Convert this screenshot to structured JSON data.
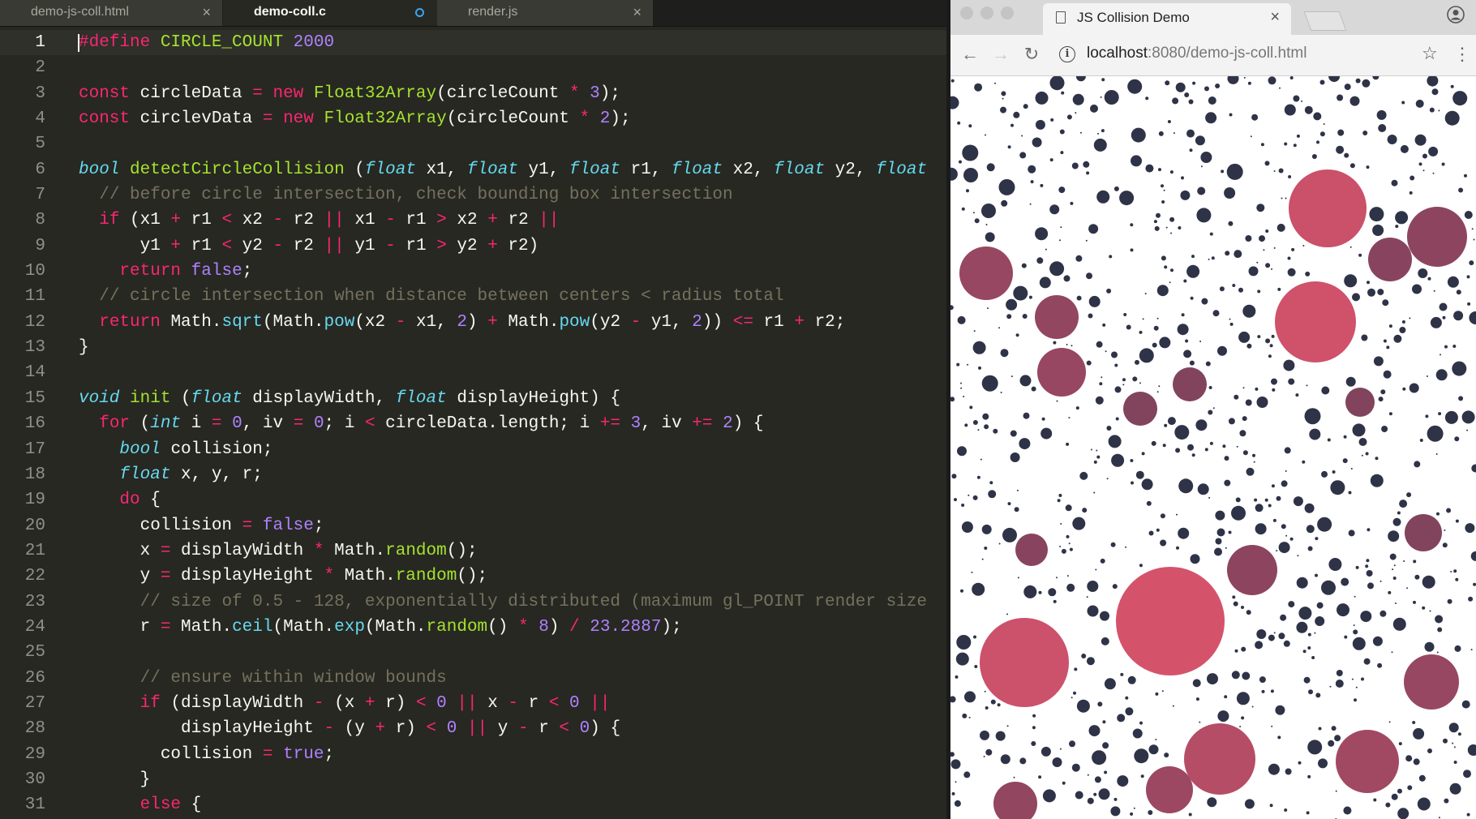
{
  "editor": {
    "tabs": [
      {
        "label": "demo-js-coll.html",
        "state": "inactive",
        "indicator": "close"
      },
      {
        "label": "demo-coll.c",
        "state": "active",
        "indicator": "modified-dot"
      },
      {
        "label": "render.js",
        "state": "inactive",
        "indicator": "close"
      }
    ],
    "close_glyph": "×",
    "current_line": 1,
    "lines": [
      [
        [
          "k",
          "#define"
        ],
        [
          "",
          ""
        ],
        [
          "f",
          " CIRCLE_COUNT"
        ],
        [
          "n",
          " 2000"
        ]
      ],
      [],
      [
        [
          "k",
          "const"
        ],
        [
          "",
          " circleData "
        ],
        [
          "k",
          "="
        ],
        [
          "",
          " "
        ],
        [
          "k",
          "new"
        ],
        [
          "",
          " "
        ],
        [
          "f",
          "Float32Array"
        ],
        [
          "",
          "(circleCount "
        ],
        [
          "k",
          "*"
        ],
        [
          "",
          " "
        ],
        [
          "n",
          "3"
        ],
        [
          "",
          ");"
        ]
      ],
      [
        [
          "k",
          "const"
        ],
        [
          "",
          " circlevData "
        ],
        [
          "k",
          "="
        ],
        [
          "",
          " "
        ],
        [
          "k",
          "new"
        ],
        [
          "",
          " "
        ],
        [
          "f",
          "Float32Array"
        ],
        [
          "",
          "(circleCount "
        ],
        [
          "k",
          "*"
        ],
        [
          "",
          " "
        ],
        [
          "n",
          "2"
        ],
        [
          "",
          ");"
        ]
      ],
      [],
      [
        [
          "s",
          "bool"
        ],
        [
          "",
          " "
        ],
        [
          "f",
          "detectCircleCollision"
        ],
        [
          "",
          " ("
        ],
        [
          "s",
          "float"
        ],
        [
          "",
          " x1, "
        ],
        [
          "s",
          "float"
        ],
        [
          "",
          " y1, "
        ],
        [
          "s",
          "float"
        ],
        [
          "",
          " r1, "
        ],
        [
          "s",
          "float"
        ],
        [
          "",
          " x2, "
        ],
        [
          "s",
          "float"
        ],
        [
          "",
          " y2, "
        ],
        [
          "s",
          "float"
        ]
      ],
      [
        [
          "",
          "  "
        ],
        [
          "c",
          "// before circle intersection, check bounding box intersection"
        ]
      ],
      [
        [
          "",
          "  "
        ],
        [
          "k",
          "if"
        ],
        [
          "",
          " (x1 "
        ],
        [
          "k",
          "+"
        ],
        [
          "",
          " r1 "
        ],
        [
          "k",
          "<"
        ],
        [
          "",
          " x2 "
        ],
        [
          "k",
          "-"
        ],
        [
          "",
          " r2 "
        ],
        [
          "k",
          "||"
        ],
        [
          "",
          " x1 "
        ],
        [
          "k",
          "-"
        ],
        [
          "",
          " r1 "
        ],
        [
          "k",
          ">"
        ],
        [
          "",
          " x2 "
        ],
        [
          "k",
          "+"
        ],
        [
          "",
          " r2 "
        ],
        [
          "k",
          "||"
        ]
      ],
      [
        [
          "",
          "      y1 "
        ],
        [
          "k",
          "+"
        ],
        [
          "",
          " r1 "
        ],
        [
          "k",
          "<"
        ],
        [
          "",
          " y2 "
        ],
        [
          "k",
          "-"
        ],
        [
          "",
          " r2 "
        ],
        [
          "k",
          "||"
        ],
        [
          "",
          " y1 "
        ],
        [
          "k",
          "-"
        ],
        [
          "",
          " r1 "
        ],
        [
          "k",
          ">"
        ],
        [
          "",
          " y2 "
        ],
        [
          "k",
          "+"
        ],
        [
          "",
          " r2)"
        ]
      ],
      [
        [
          "",
          "    "
        ],
        [
          "k",
          "return"
        ],
        [
          "",
          " "
        ],
        [
          "n",
          "false"
        ],
        [
          "",
          ";"
        ]
      ],
      [
        [
          "",
          "  "
        ],
        [
          "c",
          "// circle intersection when distance between centers < radius total"
        ]
      ],
      [
        [
          "",
          "  "
        ],
        [
          "k",
          "return"
        ],
        [
          "",
          " Math."
        ],
        [
          "m",
          "sqrt"
        ],
        [
          "",
          "(Math."
        ],
        [
          "m",
          "pow"
        ],
        [
          "",
          "(x2 "
        ],
        [
          "k",
          "-"
        ],
        [
          "",
          " x1, "
        ],
        [
          "n",
          "2"
        ],
        [
          "",
          ") "
        ],
        [
          "k",
          "+"
        ],
        [
          "",
          " Math."
        ],
        [
          "m",
          "pow"
        ],
        [
          "",
          "(y2 "
        ],
        [
          "k",
          "-"
        ],
        [
          "",
          " y1, "
        ],
        [
          "n",
          "2"
        ],
        [
          "",
          "))"
        ],
        [
          "k",
          " <="
        ],
        [
          "",
          " r1 "
        ],
        [
          "k",
          "+"
        ],
        [
          "",
          " r2;"
        ]
      ],
      [
        [
          "",
          "}"
        ]
      ],
      [],
      [
        [
          "s",
          "void"
        ],
        [
          "",
          " "
        ],
        [
          "f",
          "init"
        ],
        [
          "",
          " ("
        ],
        [
          "s",
          "float"
        ],
        [
          "",
          " displayWidth, "
        ],
        [
          "s",
          "float"
        ],
        [
          "",
          " displayHeight) {"
        ]
      ],
      [
        [
          "",
          "  "
        ],
        [
          "k",
          "for"
        ],
        [
          "",
          " ("
        ],
        [
          "s",
          "int"
        ],
        [
          "",
          " i "
        ],
        [
          "k",
          "="
        ],
        [
          "",
          " "
        ],
        [
          "n",
          "0"
        ],
        [
          "",
          ", iv "
        ],
        [
          "k",
          "="
        ],
        [
          "",
          " "
        ],
        [
          "n",
          "0"
        ],
        [
          "",
          "; i "
        ],
        [
          "k",
          "<"
        ],
        [
          "",
          " circleData.length; i "
        ],
        [
          "k",
          "+="
        ],
        [
          "",
          " "
        ],
        [
          "n",
          "3"
        ],
        [
          "",
          ", iv "
        ],
        [
          "k",
          "+="
        ],
        [
          "",
          " "
        ],
        [
          "n",
          "2"
        ],
        [
          "",
          ") {"
        ]
      ],
      [
        [
          "",
          "    "
        ],
        [
          "s",
          "bool"
        ],
        [
          "",
          " collision;"
        ]
      ],
      [
        [
          "",
          "    "
        ],
        [
          "s",
          "float"
        ],
        [
          "",
          " x, y, r;"
        ]
      ],
      [
        [
          "",
          "    "
        ],
        [
          "k",
          "do"
        ],
        [
          "",
          " {"
        ]
      ],
      [
        [
          "",
          "      collision "
        ],
        [
          "k",
          "="
        ],
        [
          "",
          " "
        ],
        [
          "n",
          "false"
        ],
        [
          "",
          ";"
        ]
      ],
      [
        [
          "",
          "      x "
        ],
        [
          "k",
          "="
        ],
        [
          "",
          " displayWidth "
        ],
        [
          "k",
          "*"
        ],
        [
          "",
          " Math."
        ],
        [
          "f",
          "random"
        ],
        [
          "",
          "();"
        ]
      ],
      [
        [
          "",
          "      y "
        ],
        [
          "k",
          "="
        ],
        [
          "",
          " displayHeight "
        ],
        [
          "k",
          "*"
        ],
        [
          "",
          " Math."
        ],
        [
          "f",
          "random"
        ],
        [
          "",
          "();"
        ]
      ],
      [
        [
          "",
          "      "
        ],
        [
          "c",
          "// size of 0.5 - 128, exponentially distributed (maximum gl_POINT render size"
        ]
      ],
      [
        [
          "",
          "      r "
        ],
        [
          "k",
          "="
        ],
        [
          "",
          " Math."
        ],
        [
          "m",
          "ceil"
        ],
        [
          "",
          "(Math."
        ],
        [
          "m",
          "exp"
        ],
        [
          "",
          "(Math."
        ],
        [
          "f",
          "random"
        ],
        [
          "",
          "() "
        ],
        [
          "k",
          "*"
        ],
        [
          "",
          " "
        ],
        [
          "n",
          "8"
        ],
        [
          "",
          ") "
        ],
        [
          "k",
          "/"
        ],
        [
          "",
          " "
        ],
        [
          "n",
          "23.2887"
        ],
        [
          "",
          ");"
        ]
      ],
      [],
      [
        [
          "",
          "      "
        ],
        [
          "c",
          "// ensure within window bounds"
        ]
      ],
      [
        [
          "",
          "      "
        ],
        [
          "k",
          "if"
        ],
        [
          "",
          " (displayWidth "
        ],
        [
          "k",
          "-"
        ],
        [
          "",
          " (x "
        ],
        [
          "k",
          "+"
        ],
        [
          "",
          " r) "
        ],
        [
          "k",
          "<"
        ],
        [
          "",
          " "
        ],
        [
          "n",
          "0"
        ],
        [
          "",
          " "
        ],
        [
          "k",
          "||"
        ],
        [
          "",
          " x "
        ],
        [
          "k",
          "-"
        ],
        [
          "",
          " r "
        ],
        [
          "k",
          "<"
        ],
        [
          "",
          " "
        ],
        [
          "n",
          "0"
        ],
        [
          "",
          " "
        ],
        [
          "k",
          "||"
        ]
      ],
      [
        [
          "",
          "          displayHeight "
        ],
        [
          "k",
          "-"
        ],
        [
          "",
          " (y "
        ],
        [
          "k",
          "+"
        ],
        [
          "",
          " r) "
        ],
        [
          "k",
          "<"
        ],
        [
          "",
          " "
        ],
        [
          "n",
          "0"
        ],
        [
          "",
          " "
        ],
        [
          "k",
          "||"
        ],
        [
          "",
          " y "
        ],
        [
          "k",
          "-"
        ],
        [
          "",
          " r "
        ],
        [
          "k",
          "<"
        ],
        [
          "",
          " "
        ],
        [
          "n",
          "0"
        ],
        [
          "",
          ") {"
        ]
      ],
      [
        [
          "",
          "        collision "
        ],
        [
          "k",
          "="
        ],
        [
          "",
          " "
        ],
        [
          "n",
          "true"
        ],
        [
          "",
          ";"
        ]
      ],
      [
        [
          "",
          "      }"
        ]
      ],
      [
        [
          "",
          "      "
        ],
        [
          "k",
          "else"
        ],
        [
          "",
          " {"
        ]
      ]
    ]
  },
  "browser": {
    "tab_title": "JS Collision Demo",
    "tab_close": "×",
    "tab_icon": "page-icon",
    "url_host": "localhost",
    "url_rest": ":8080/demo-js-coll.html",
    "back_glyph": "←",
    "forward_glyph": "→",
    "reload_glyph": "↻",
    "star_glyph": "☆",
    "menu_glyph": "⋮",
    "info_glyph": "i"
  },
  "colors": {
    "editor_bg": "#272822",
    "small_circle": "#2f3347",
    "big_circle_light": "#d4536b",
    "big_circle_dark": "#6e3f5a"
  }
}
